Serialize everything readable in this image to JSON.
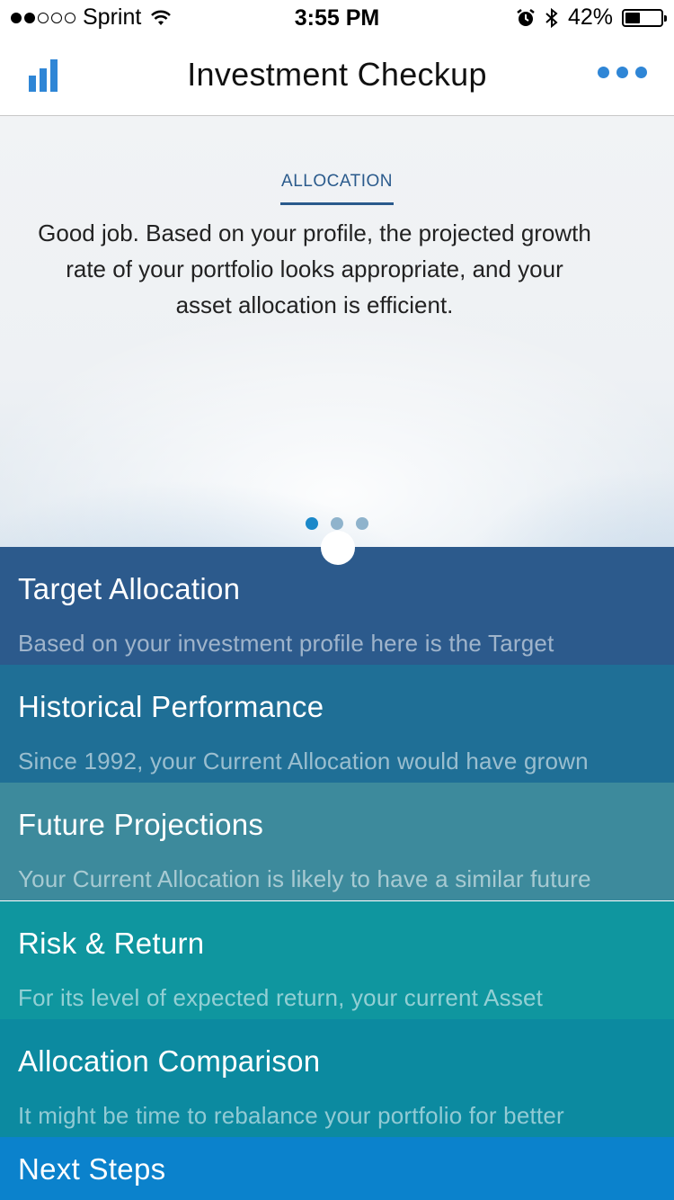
{
  "status_bar": {
    "signal_dots": [
      true,
      true,
      false,
      false,
      false
    ],
    "carrier": "Sprint",
    "time": "3:55 PM",
    "battery_percent": "42%",
    "battery_level": 0.42
  },
  "nav": {
    "title": "Investment Checkup",
    "left_icon": "bar-chart-icon",
    "right_icon": "more-icon",
    "accent_color": "#2f86d6"
  },
  "hero": {
    "label": "ALLOCATION",
    "message": "Good job. Based on your profile, the projected growth rate of your portfolio looks appropriate, and your asset allocation is efficient.",
    "page_count": 3,
    "active_page": 0
  },
  "cards": [
    {
      "title": "Target Allocation",
      "description": "Based on your investment profile here is the Target",
      "color": "#2c5a8c"
    },
    {
      "title": "Historical Performance",
      "description": "Since 1992, your Current Allocation would have grown",
      "color": "#1f6f96"
    },
    {
      "title": "Future Projections",
      "description": "Your Current Allocation is likely to have a similar future",
      "color": "#3d8a9c"
    },
    {
      "title": "Risk & Return",
      "description": "For its level of expected return, your current Asset",
      "color": "#0f969f"
    },
    {
      "title": "Allocation Comparison",
      "description": "It might be time to rebalance your portfolio for better",
      "color": "#0c8aa0"
    }
  ],
  "next_steps": {
    "label": "Next Steps",
    "color": "#0b82cc"
  }
}
